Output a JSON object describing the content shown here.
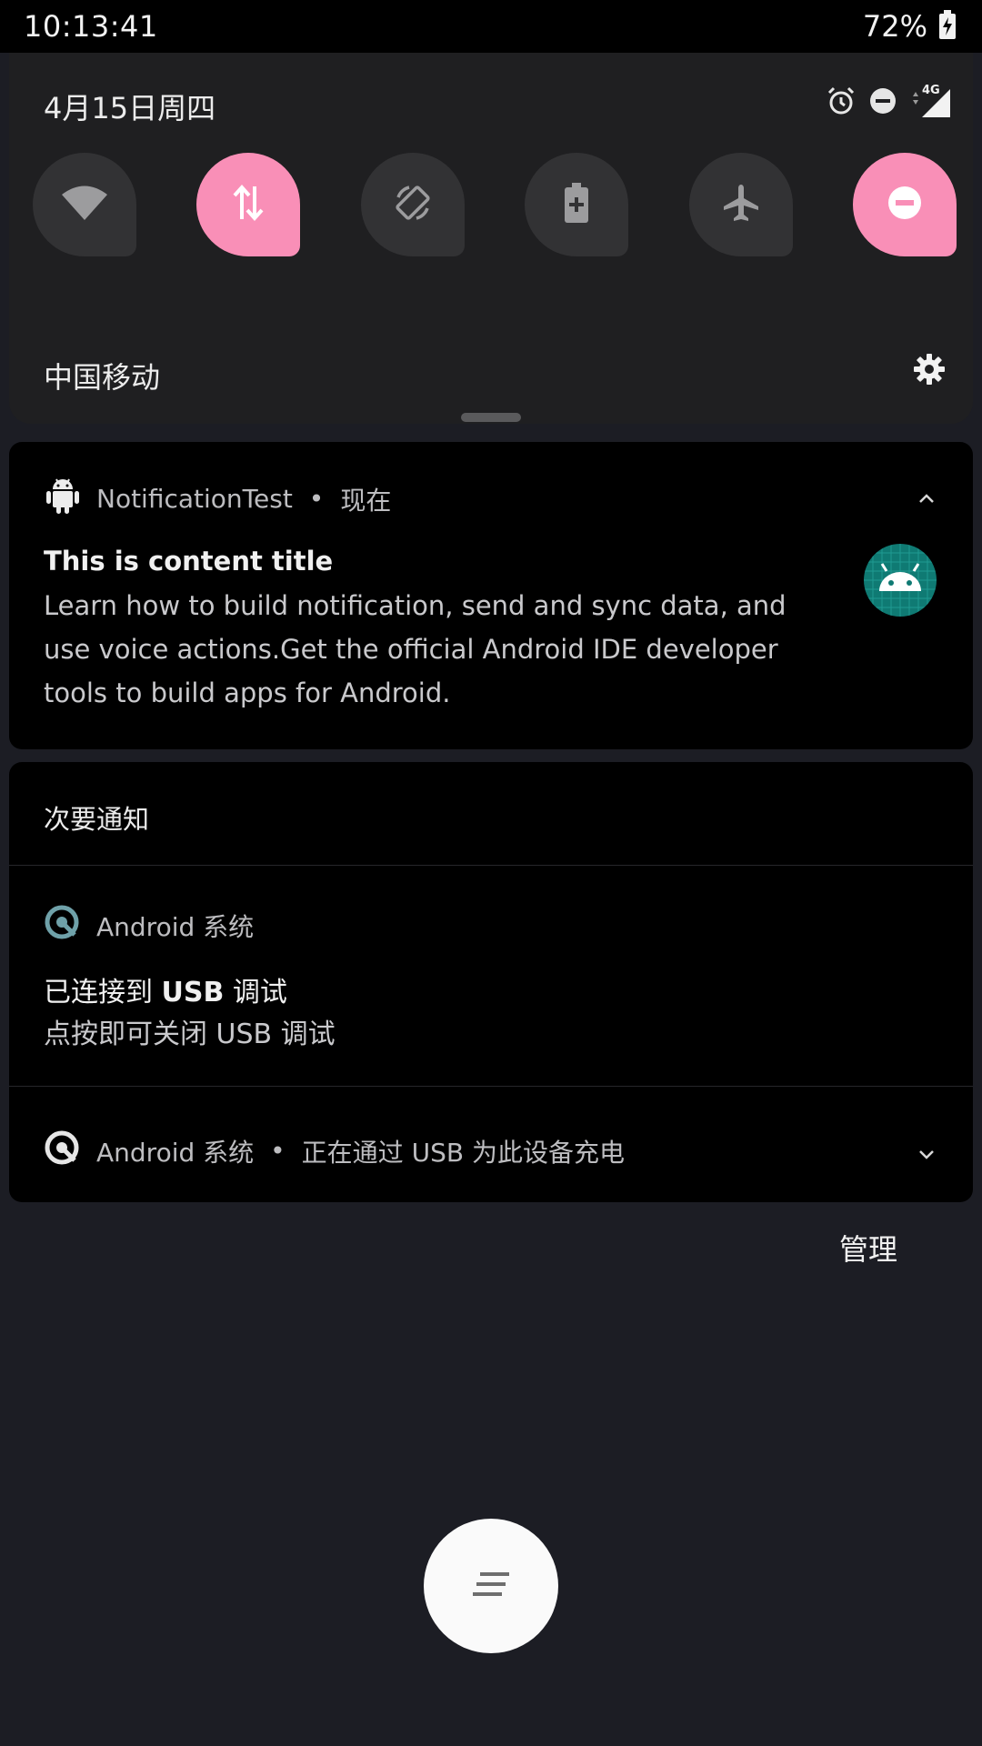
{
  "status_bar": {
    "time": "10:13:41",
    "battery_text": "72%",
    "icons": [
      "battery-charging-icon"
    ]
  },
  "quick_settings": {
    "date": "4月15日周四",
    "status_icons": [
      "alarm-icon",
      "do-not-disturb-icon",
      "signal-4g-icon"
    ],
    "network_type": "4G",
    "tiles": [
      {
        "name": "wifi",
        "icon": "wifi-icon",
        "active": false
      },
      {
        "name": "mobile-data",
        "icon": "data-arrows-icon",
        "active": true
      },
      {
        "name": "auto-rotate",
        "icon": "rotate-icon",
        "active": false
      },
      {
        "name": "battery-saver",
        "icon": "battery-saver-icon",
        "active": false
      },
      {
        "name": "airplane-mode",
        "icon": "airplane-icon",
        "active": false
      },
      {
        "name": "do-not-disturb",
        "icon": "do-not-disturb-icon",
        "active": true
      }
    ],
    "carrier": "中国移动",
    "settings_icon": "gear-icon"
  },
  "notification": {
    "app_name": "NotificationTest",
    "time": "现在",
    "title": "This is content title",
    "text": "Learn how to build notification, send and sync data, and use voice actions.Get the official Android IDE developer tools to build apps for Android.",
    "large_icon": "android-robot-icon"
  },
  "secondary": {
    "section_title": "次要通知",
    "usb_debug": {
      "app_name": "Android 系统",
      "title_prefix": "已连接到 ",
      "title_bold": "USB",
      "title_suffix": " 调试",
      "text": "点按即可关闭 USB 调试"
    },
    "charging": {
      "app_name": "Android 系统",
      "summary": "正在通过 USB 为此设备充电"
    }
  },
  "manage_label": "管理",
  "colors": {
    "accent_pink": "#f98fb7",
    "panel": "#1f1f21",
    "card": "#000000",
    "background": "#1c1d24",
    "android_green": "#0f7a73"
  }
}
